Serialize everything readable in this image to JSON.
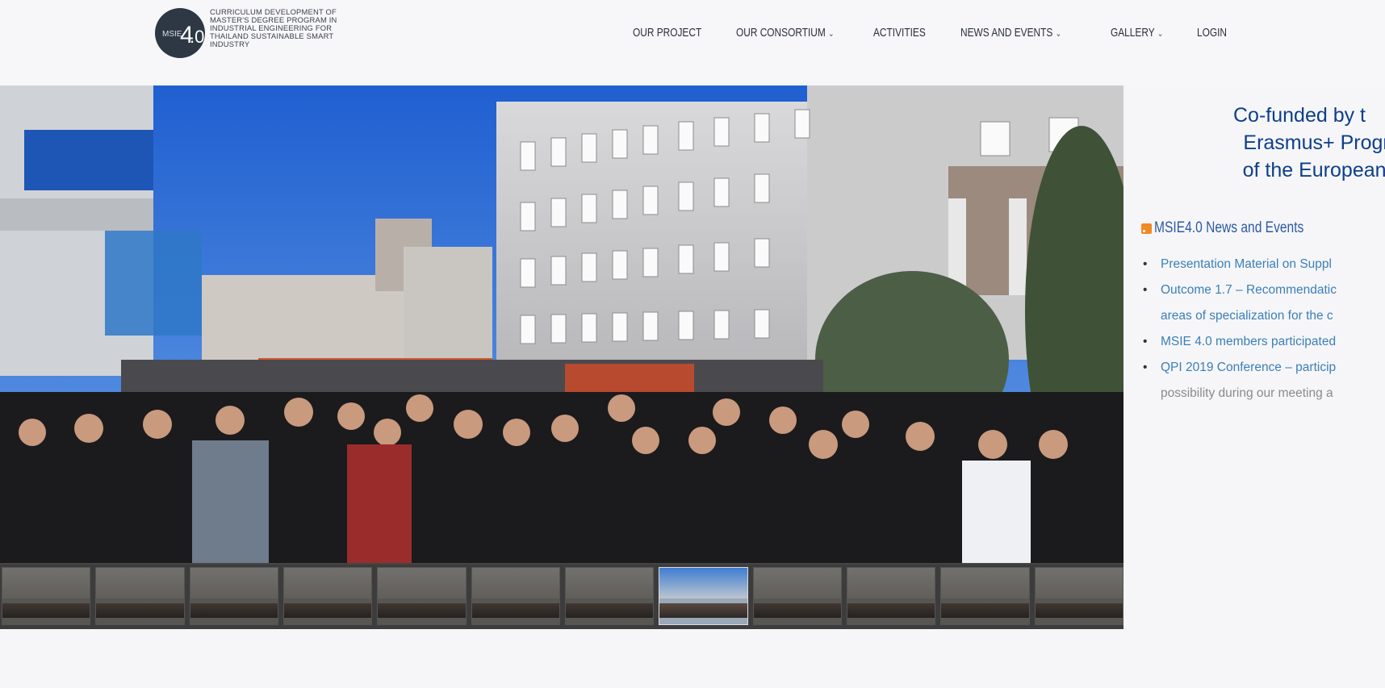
{
  "header": {
    "logo_mark": "MSIE4.0",
    "logo_text": "CURRICULUM DEVELOPMENT OF MASTER'S DEGREE PROGRAM IN INDUSTRIAL ENGINEERING FOR THAILAND SUSTAINABLE SMART INDUSTRY",
    "nav": [
      {
        "label": "OUR PROJECT",
        "dropdown": false
      },
      {
        "label": "OUR CONSORTIUM",
        "dropdown": true
      },
      {
        "label": "ACTIVITIES",
        "dropdown": false
      },
      {
        "label": "NEWS AND EVENTS",
        "dropdown": true
      },
      {
        "label": "GALLERY",
        "dropdown": true
      },
      {
        "label": "LOGIN",
        "dropdown": false
      }
    ]
  },
  "slider": {
    "thumbnail_count": 12,
    "active_thumbnail": 8
  },
  "sidebar": {
    "cofunded": [
      "Co-funded by t",
      "Erasmus+ Programi",
      "of the European Uni"
    ],
    "news_title": "MSIE4.0 News and Events",
    "news_items": [
      "Presentation Material on Suppl",
      "Outcome 1.7 – Recommendatic",
      "areas of specialization for the c",
      "MSIE 4.0 members participated",
      "QPI 2019 Conference – particip",
      "possibility during our meeting a"
    ]
  },
  "colors": {
    "logo_bg": "#2e3845",
    "cofunded_text": "#0d3f8a",
    "news_title": "#2d5aa3",
    "news_link": "#3b7fb8",
    "rss": "#f08a24"
  }
}
